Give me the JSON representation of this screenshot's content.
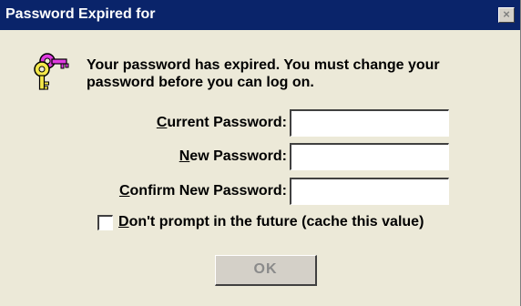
{
  "window": {
    "title": "Password Expired for",
    "close_symbol": "×"
  },
  "icon": "keys-icon",
  "message": "Your password has expired. You must change your password before you can log on.",
  "fields": {
    "current_password": {
      "mnemonic": "C",
      "rest": "urrent Password:",
      "value": ""
    },
    "new_password": {
      "mnemonic": "N",
      "rest": "ew Password:",
      "value": ""
    },
    "confirm_password": {
      "mnemonic": "C",
      "rest": "onfirm New Password:",
      "value": ""
    }
  },
  "cache_option": {
    "mnemonic": "D",
    "rest": "on't prompt in the future (cache this value)",
    "checked": false
  },
  "ok_button": {
    "label": "OK",
    "enabled": false
  },
  "colors": {
    "titlebar": "#0a246a",
    "dialog_bg": "#ece9d8",
    "disabled_text": "#8a8a8a"
  }
}
